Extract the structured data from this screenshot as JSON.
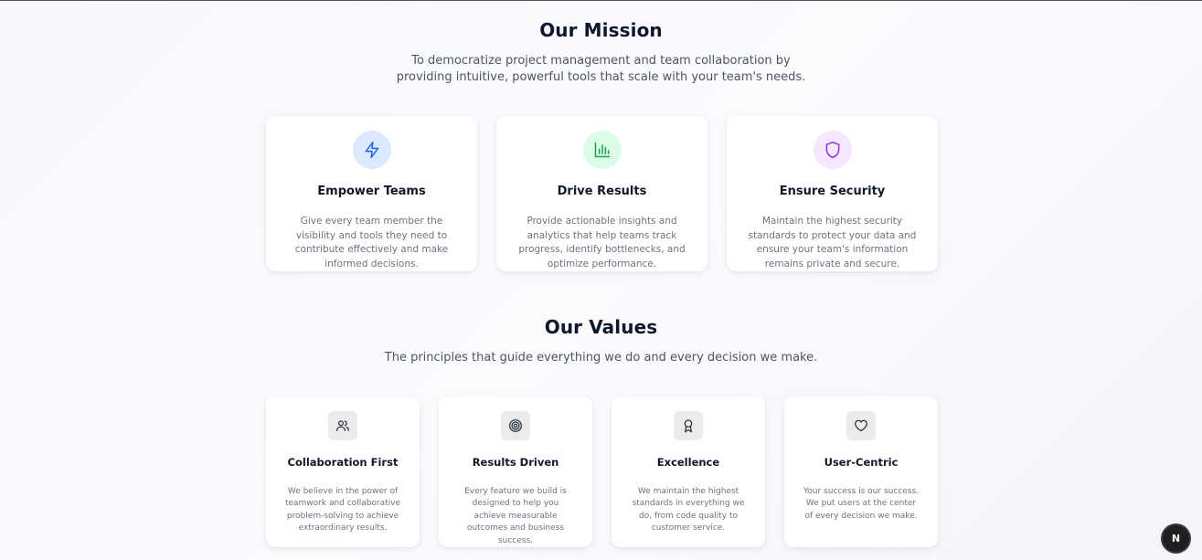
{
  "mission": {
    "title": "Our Mission",
    "lead": "To democratize project management and team collaboration by providing intuitive, powerful tools that scale with your team's needs.",
    "cards": [
      {
        "icon": "lightning-icon",
        "title": "Empower Teams",
        "text": "Give every team member the visibility and tools they need to contribute effectively and make informed decisions.",
        "icon_color": "#2563eb",
        "icon_bg": "#dbeafe"
      },
      {
        "icon": "bar-chart-icon",
        "title": "Drive Results",
        "text": "Provide actionable insights and analytics that help teams track progress, identify bottlenecks, and optimize performance.",
        "icon_color": "#16a34a",
        "icon_bg": "#dcfce7"
      },
      {
        "icon": "shield-icon",
        "title": "Ensure Security",
        "text": "Maintain the highest security standards to protect your data and ensure your team's information remains private and secure.",
        "icon_color": "#9333ea",
        "icon_bg": "#f3e8ff"
      }
    ]
  },
  "values": {
    "title": "Our Values",
    "lead": "The principles that guide everything we do and every decision we make.",
    "cards": [
      {
        "icon": "users-icon",
        "title": "Collaboration First",
        "text": "We believe in the power of teamwork and collaborative problem-solving to achieve extraordinary results."
      },
      {
        "icon": "target-icon",
        "title": "Results Driven",
        "text": "Every feature we build is designed to help you achieve measurable outcomes and business success."
      },
      {
        "icon": "award-icon",
        "title": "Excellence",
        "text": "We maintain the highest standards in everything we do, from code quality to customer service."
      },
      {
        "icon": "heart-icon",
        "title": "User-Centric",
        "text": "Your success is our success. We put users at the center of every decision we make."
      }
    ]
  },
  "badge": {
    "label": "N",
    "icon": "nextjs-icon"
  }
}
